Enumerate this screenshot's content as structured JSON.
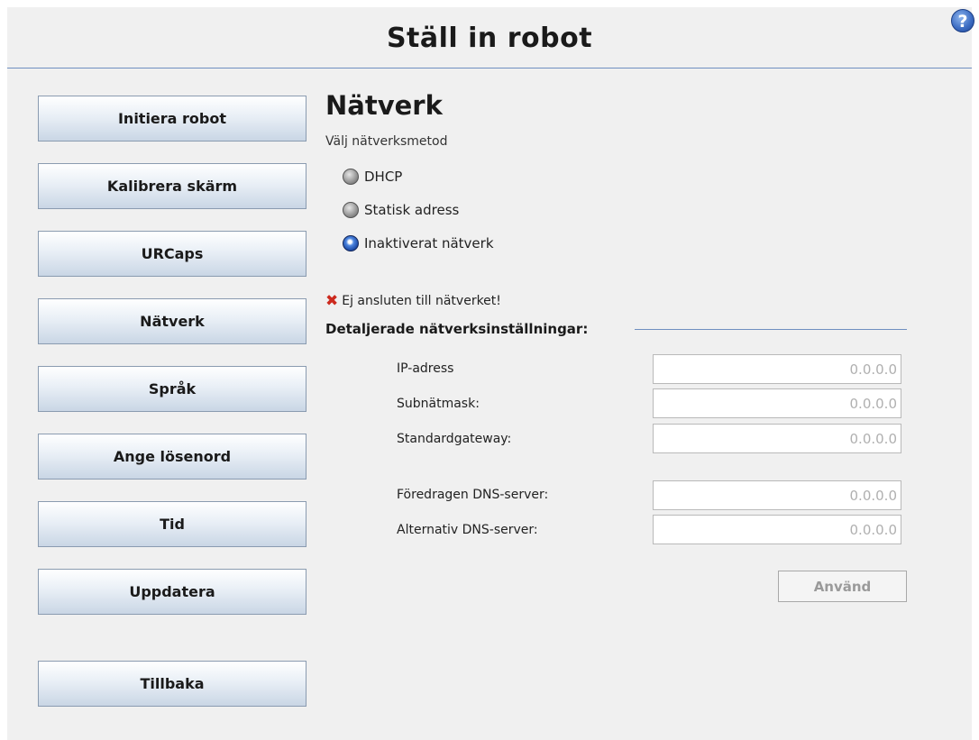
{
  "header": {
    "title": "Ställ in robot",
    "help_glyph": "?"
  },
  "nav": {
    "items": [
      {
        "label": "Initiera robot"
      },
      {
        "label": "Kalibrera skärm"
      },
      {
        "label": "URCaps"
      },
      {
        "label": "Nätverk"
      },
      {
        "label": "Språk"
      },
      {
        "label": "Ange lösenord"
      },
      {
        "label": "Tid"
      },
      {
        "label": "Uppdatera"
      }
    ],
    "back_label": "Tillbaka"
  },
  "network": {
    "title": "Nätverk",
    "subtitle": "Välj nätverksmetod",
    "methods": [
      {
        "label": "DHCP",
        "selected": false
      },
      {
        "label": "Statisk adress",
        "selected": false
      },
      {
        "label": "Inaktiverat nätverk",
        "selected": true
      }
    ],
    "status_text": "Ej ansluten till nätverket!",
    "status_icon": "error-x-icon",
    "details_label": "Detaljerade nätverksinställningar:",
    "fields": [
      {
        "label": "IP-adress",
        "placeholder": "0.0.0.0"
      },
      {
        "label": "Subnätmask:",
        "placeholder": "0.0.0.0"
      },
      {
        "label": "Standardgateway:",
        "placeholder": "0.0.0.0"
      },
      {
        "label": "Föredragen DNS-server:",
        "placeholder": "0.0.0.0"
      },
      {
        "label": "Alternativ DNS-server:",
        "placeholder": "0.0.0.0"
      }
    ],
    "apply_label": "Använd"
  },
  "colors": {
    "accent_line": "#6f8fc0",
    "error_icon": "#cc2a1e",
    "selected_radio": "#1c4aa6"
  }
}
